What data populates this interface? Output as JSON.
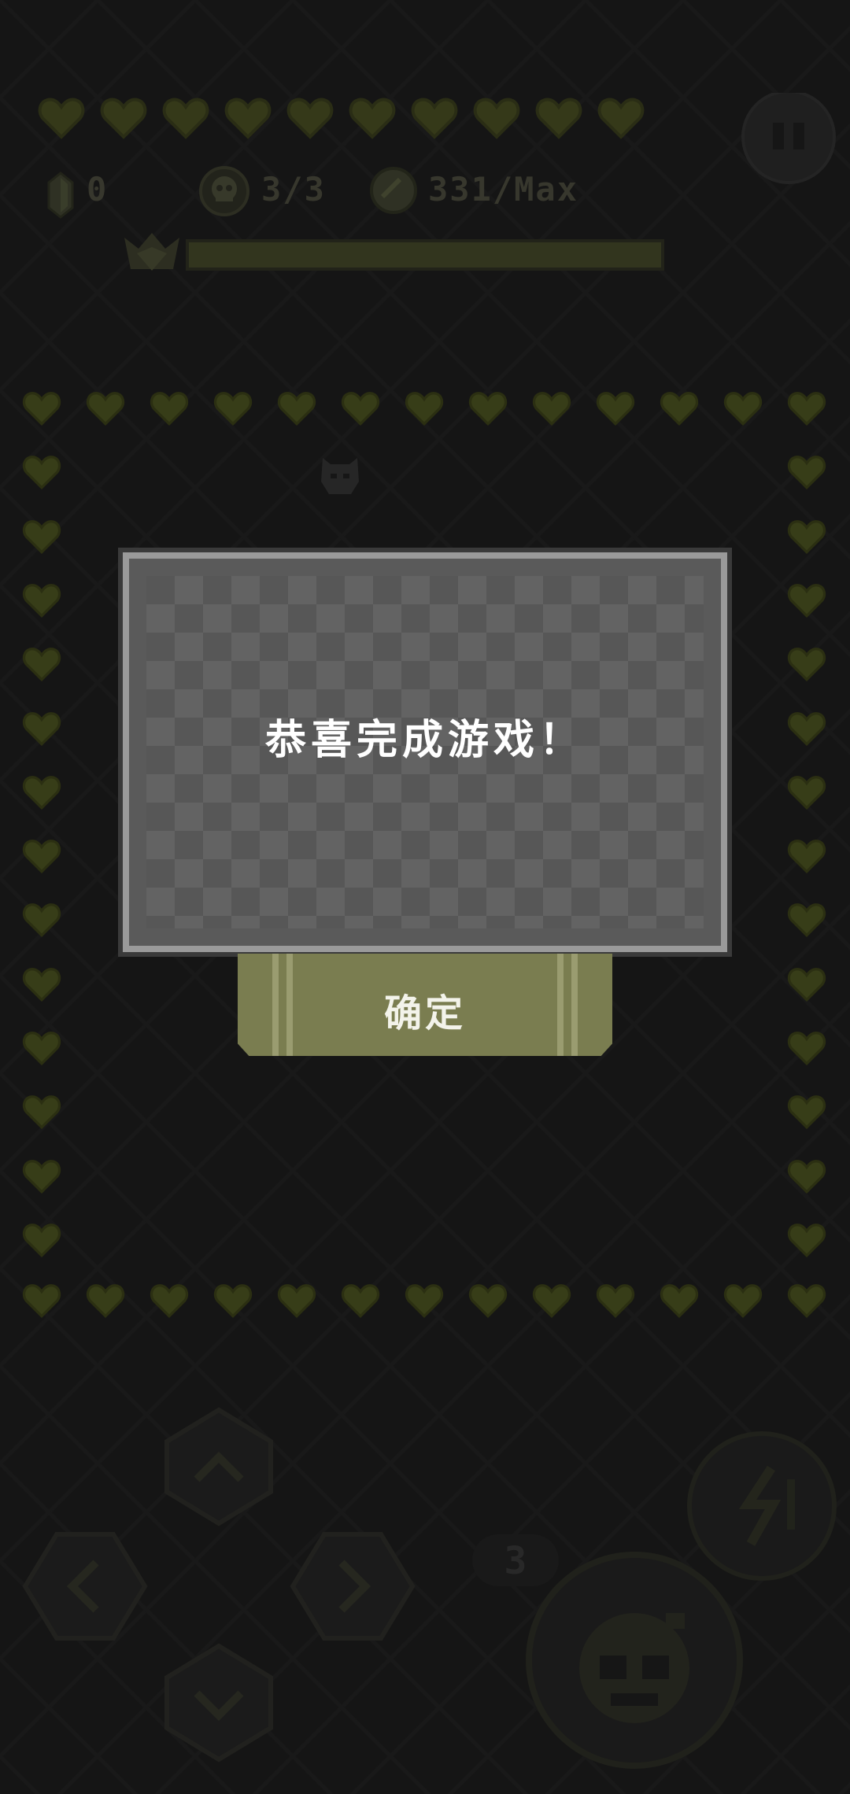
{
  "hud": {
    "hearts_count": 10,
    "gems": "0",
    "skulls": "3/3",
    "coins": "331/Max",
    "boss_progress": 1.0
  },
  "dialog": {
    "message": "恭喜完成游戏！",
    "confirm_label": "确定"
  },
  "controls": {
    "bomb_count": "3"
  },
  "colors": {
    "accent": "#7a7d50",
    "heart": "#4a5020",
    "dialog_bg": "#5a5a5a"
  },
  "icons": [
    "heart-icon",
    "gem-icon",
    "skull-icon",
    "coin-icon",
    "pause-icon",
    "crown-icon",
    "arrow-up-icon",
    "arrow-down-icon",
    "arrow-left-icon",
    "arrow-right-icon",
    "dash-icon",
    "bomb-icon"
  ]
}
